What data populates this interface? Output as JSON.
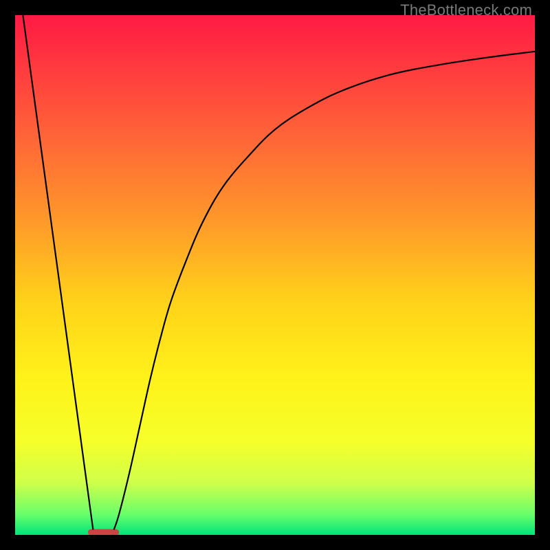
{
  "watermark": "TheBottleneck.com",
  "chart_data": {
    "type": "line",
    "title": "",
    "xlabel": "",
    "ylabel": "",
    "xlim": [
      0,
      100
    ],
    "ylim": [
      0,
      100
    ],
    "background_gradient": {
      "stops": [
        {
          "offset": 0.0,
          "color": "#ff1a44"
        },
        {
          "offset": 0.2,
          "color": "#ff5a3a"
        },
        {
          "offset": 0.4,
          "color": "#ff9a2a"
        },
        {
          "offset": 0.55,
          "color": "#ffd21a"
        },
        {
          "offset": 0.7,
          "color": "#fff21a"
        },
        {
          "offset": 0.82,
          "color": "#f6ff2a"
        },
        {
          "offset": 0.9,
          "color": "#cfff4a"
        },
        {
          "offset": 0.96,
          "color": "#6aff6a"
        },
        {
          "offset": 1.0,
          "color": "#00e47a"
        }
      ]
    },
    "valley_marker": {
      "x_center": 17.0,
      "x_half_width": 3.0,
      "y": 0.5,
      "color": "#cc4444",
      "height": 1.2
    },
    "series": [
      {
        "name": "left-slope",
        "x": [
          1.5,
          15.0
        ],
        "y": [
          100.0,
          1.0
        ]
      },
      {
        "name": "right-curve",
        "x": [
          19,
          20,
          22,
          24,
          26,
          28,
          30,
          33,
          36,
          40,
          45,
          50,
          56,
          63,
          72,
          82,
          92,
          100
        ],
        "y": [
          1,
          4,
          12,
          21,
          30,
          38,
          45,
          53,
          60,
          67,
          73,
          78,
          82,
          85.5,
          88.5,
          90.5,
          92,
          93
        ]
      }
    ]
  }
}
